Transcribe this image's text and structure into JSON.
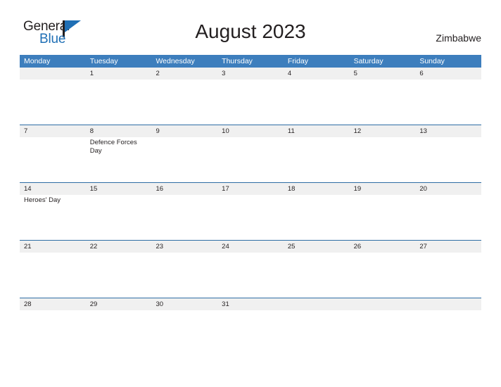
{
  "brand": {
    "name_part1": "General",
    "name_part2": "Blue",
    "triangle_color": "#1f6fb5"
  },
  "header": {
    "title": "August 2023",
    "country": "Zimbabwe"
  },
  "colors": {
    "header_bar": "#3d7ebd",
    "row_divider": "#2e6da4",
    "date_band": "#f0f0f0",
    "brand_blue": "#1f6fb5",
    "text": "#231f20"
  },
  "calendar": {
    "month": "August",
    "year": "2023",
    "weekday_headers": [
      "Monday",
      "Tuesday",
      "Wednesday",
      "Thursday",
      "Friday",
      "Saturday",
      "Sunday"
    ],
    "weeks": [
      {
        "days": [
          {
            "number": "",
            "events": []
          },
          {
            "number": "1",
            "events": []
          },
          {
            "number": "2",
            "events": []
          },
          {
            "number": "3",
            "events": []
          },
          {
            "number": "4",
            "events": []
          },
          {
            "number": "5",
            "events": []
          },
          {
            "number": "6",
            "events": []
          }
        ]
      },
      {
        "days": [
          {
            "number": "7",
            "events": []
          },
          {
            "number": "8",
            "events": [
              "Defence Forces Day"
            ]
          },
          {
            "number": "9",
            "events": []
          },
          {
            "number": "10",
            "events": []
          },
          {
            "number": "11",
            "events": []
          },
          {
            "number": "12",
            "events": []
          },
          {
            "number": "13",
            "events": []
          }
        ]
      },
      {
        "days": [
          {
            "number": "14",
            "events": [
              "Heroes' Day"
            ]
          },
          {
            "number": "15",
            "events": []
          },
          {
            "number": "16",
            "events": []
          },
          {
            "number": "17",
            "events": []
          },
          {
            "number": "18",
            "events": []
          },
          {
            "number": "19",
            "events": []
          },
          {
            "number": "20",
            "events": []
          }
        ]
      },
      {
        "days": [
          {
            "number": "21",
            "events": []
          },
          {
            "number": "22",
            "events": []
          },
          {
            "number": "23",
            "events": []
          },
          {
            "number": "24",
            "events": []
          },
          {
            "number": "25",
            "events": []
          },
          {
            "number": "26",
            "events": []
          },
          {
            "number": "27",
            "events": []
          }
        ]
      },
      {
        "days": [
          {
            "number": "28",
            "events": []
          },
          {
            "number": "29",
            "events": []
          },
          {
            "number": "30",
            "events": []
          },
          {
            "number": "31",
            "events": []
          },
          {
            "number": "",
            "events": []
          },
          {
            "number": "",
            "events": []
          },
          {
            "number": "",
            "events": []
          }
        ]
      }
    ]
  }
}
